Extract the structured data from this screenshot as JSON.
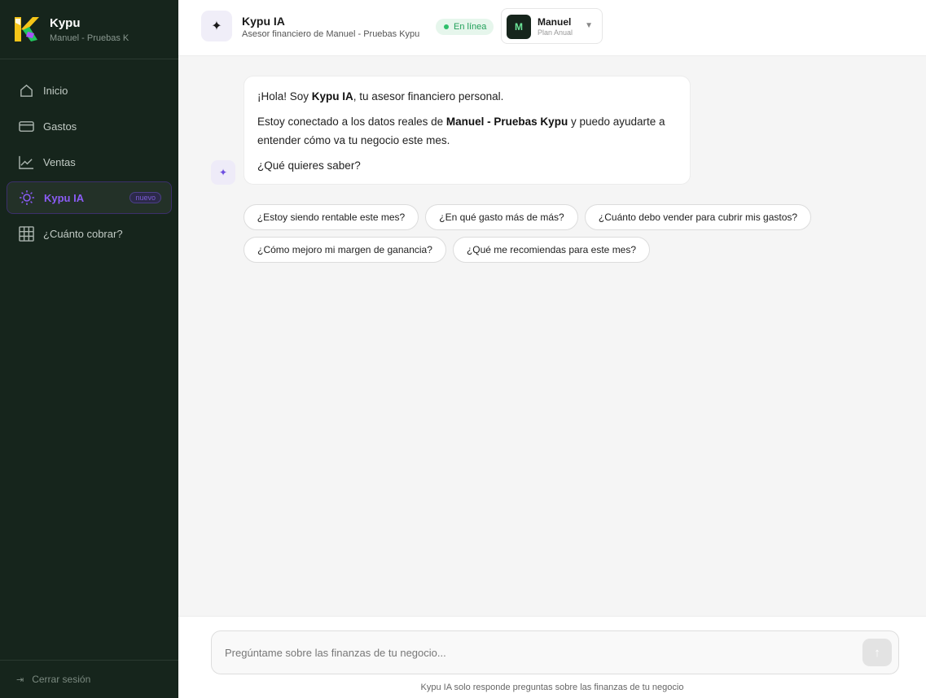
{
  "app": {
    "name": "Kypu",
    "org": "Manuel - Pruebas K",
    "logo_colors": [
      "#f5c518",
      "#22c55e",
      "#a855f7",
      "#ffffff"
    ]
  },
  "sidebar": {
    "items": [
      {
        "label": "Inicio",
        "icon": "home-icon",
        "active": false
      },
      {
        "label": "Gastos",
        "icon": "credit-card-icon",
        "active": false
      },
      {
        "label": "Ventas",
        "icon": "line-chart-icon",
        "active": false
      },
      {
        "label": "Kypu IA",
        "icon": "sun-icon",
        "active": true,
        "badge": "nuevo"
      },
      {
        "label": "¿Cuánto cobrar?",
        "icon": "grid-icon",
        "active": false
      }
    ],
    "logout_label": "Cerrar sesión",
    "logout_icon": "logout-icon"
  },
  "header": {
    "icon": "sparkle-icon",
    "title": "Kypu IA",
    "subtitle": "Asesor financiero de Manuel - Pruebas Kypu",
    "status": "En línea",
    "user": {
      "initial": "M",
      "name": "Manuel",
      "plan": "Plan Anual"
    }
  },
  "chat": {
    "message": {
      "greeting_pre": "¡Hola! Soy ",
      "greeting_bold": "Kypu IA",
      "greeting_post": ", tu asesor financiero personal.",
      "line2_pre": "Estoy conectado a los datos reales de ",
      "line2_bold": "Manuel - Pruebas Kypu",
      "line2_post": " y puedo ayudarte a entender cómo va tu negocio este mes.",
      "question": "¿Qué quieres saber?"
    },
    "suggestions": [
      "¿Estoy siendo rentable este mes?",
      "¿En qué gasto más de más?",
      "¿Cuánto debo vender para cubrir mis gastos?",
      "¿Cómo mejoro mi margen de ganancia?",
      "¿Qué me recomiendas para este mes?"
    ]
  },
  "composer": {
    "placeholder": "Pregúntame sobre las finanzas de tu negocio...",
    "send_icon": "arrow-up-icon",
    "footnote": "Kypu IA solo responde preguntas sobre las finanzas de tu negocio"
  },
  "colors": {
    "sidebar_bg": "#16251c",
    "accent": "#8b5cf6",
    "online_green": "#22a05a"
  }
}
